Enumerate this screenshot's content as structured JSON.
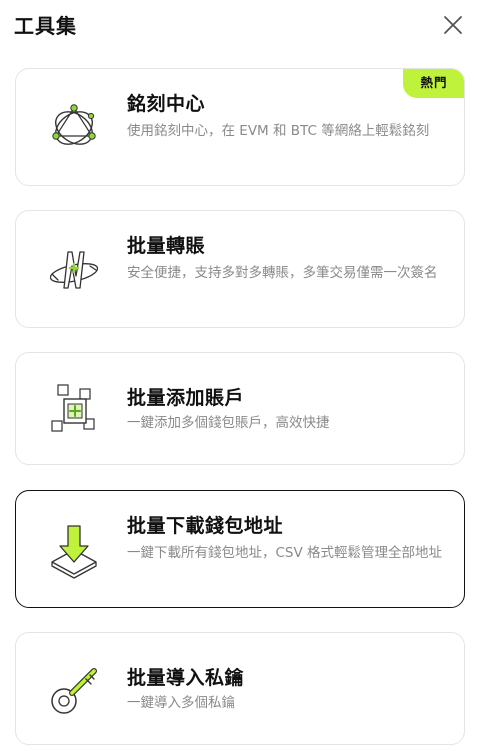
{
  "header": {
    "title": "工具集"
  },
  "tools": [
    {
      "title": "銘刻中心",
      "description": "使用銘刻中心，在 EVM 和 BTC 等網絡上輕鬆銘刻",
      "badge": "熱門",
      "icon": "inscription-orbit-icon"
    },
    {
      "title": "批量轉賬",
      "description": "安全便捷，支持多對多轉賬，多筆交易僅需一次簽名",
      "icon": "batch-transfer-icon"
    },
    {
      "title": "批量添加賬戶",
      "description": "一鍵添加多個錢包賬戶，高效快捷",
      "icon": "batch-add-account-icon"
    },
    {
      "title": "批量下載錢包地址",
      "description": "一鍵下載所有錢包地址，CSV 格式輕鬆管理全部地址",
      "icon": "download-address-icon",
      "selected": true
    },
    {
      "title": "批量導入私鑰",
      "description": "一鍵導入多個私鑰",
      "icon": "import-key-icon"
    }
  ],
  "colors": {
    "accent": "#bff23a",
    "text_primary": "#111111",
    "text_secondary": "#8a8a8a",
    "card_border": "#e4e4e4",
    "icon_green": "#8ed63a"
  }
}
